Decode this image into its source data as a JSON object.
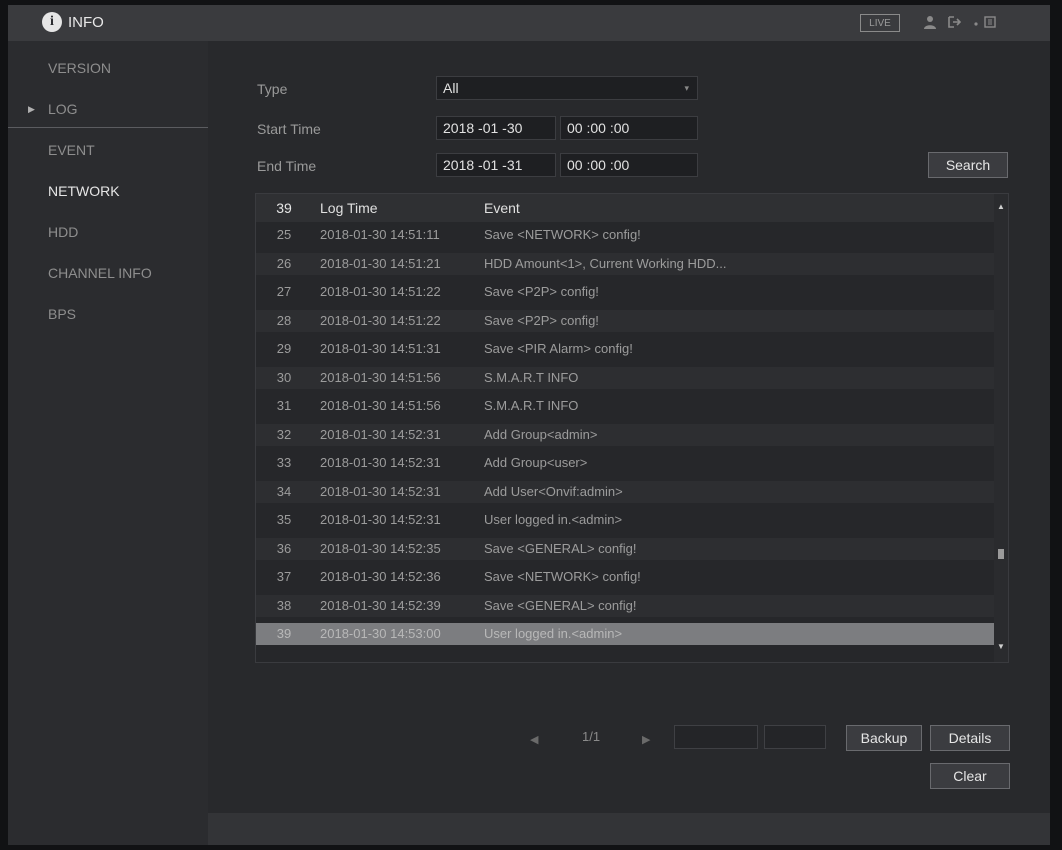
{
  "header": {
    "title": "INFO",
    "live_label": "LIVE"
  },
  "sidebar": {
    "items": [
      {
        "label": "VERSION"
      },
      {
        "label": "LOG"
      },
      {
        "label": "EVENT"
      },
      {
        "label": "NETWORK"
      },
      {
        "label": "HDD"
      },
      {
        "label": "CHANNEL INFO"
      },
      {
        "label": "BPS"
      }
    ]
  },
  "filter": {
    "type_label": "Type",
    "type_value": "All",
    "start_label": "Start Time",
    "start_date": "2018 -01 -30",
    "start_time": "00 :00 :00",
    "end_label": "End Time",
    "end_date": "2018 -01 -31",
    "end_time": "00 :00 :00",
    "search_label": "Search"
  },
  "log_table": {
    "count": "39",
    "col_time": "Log Time",
    "col_event": "Event",
    "rows": [
      {
        "no": "25",
        "time": "2018-01-30 14:51:11",
        "event": "Save <NETWORK> config!"
      },
      {
        "no": "26",
        "time": "2018-01-30 14:51:21",
        "event": "HDD Amount<1>, Current Working HDD..."
      },
      {
        "no": "27",
        "time": "2018-01-30 14:51:22",
        "event": "Save <P2P> config!"
      },
      {
        "no": "28",
        "time": "2018-01-30 14:51:22",
        "event": "Save <P2P> config!"
      },
      {
        "no": "29",
        "time": "2018-01-30 14:51:31",
        "event": "Save <PIR Alarm> config!"
      },
      {
        "no": "30",
        "time": "2018-01-30 14:51:56",
        "event": "S.M.A.R.T INFO"
      },
      {
        "no": "31",
        "time": "2018-01-30 14:51:56",
        "event": "S.M.A.R.T INFO"
      },
      {
        "no": "32",
        "time": "2018-01-30 14:52:31",
        "event": "Add Group<admin>"
      },
      {
        "no": "33",
        "time": "2018-01-30 14:52:31",
        "event": "Add Group<user>"
      },
      {
        "no": "34",
        "time": "2018-01-30 14:52:31",
        "event": "Add User<Onvif:admin>"
      },
      {
        "no": "35",
        "time": "2018-01-30 14:52:31",
        "event": "User logged in.<admin>"
      },
      {
        "no": "36",
        "time": "2018-01-30 14:52:35",
        "event": "Save <GENERAL> config!"
      },
      {
        "no": "37",
        "time": "2018-01-30 14:52:36",
        "event": "Save <NETWORK> config!"
      },
      {
        "no": "38",
        "time": "2018-01-30 14:52:39",
        "event": "Save <GENERAL> config!"
      },
      {
        "no": "39",
        "time": "2018-01-30 14:53:00",
        "event": "User logged in.<admin>"
      }
    ]
  },
  "pager": {
    "page": "1/1"
  },
  "actions": {
    "backup_label": "Backup",
    "details_label": "Details",
    "clear_label": "Clear"
  }
}
